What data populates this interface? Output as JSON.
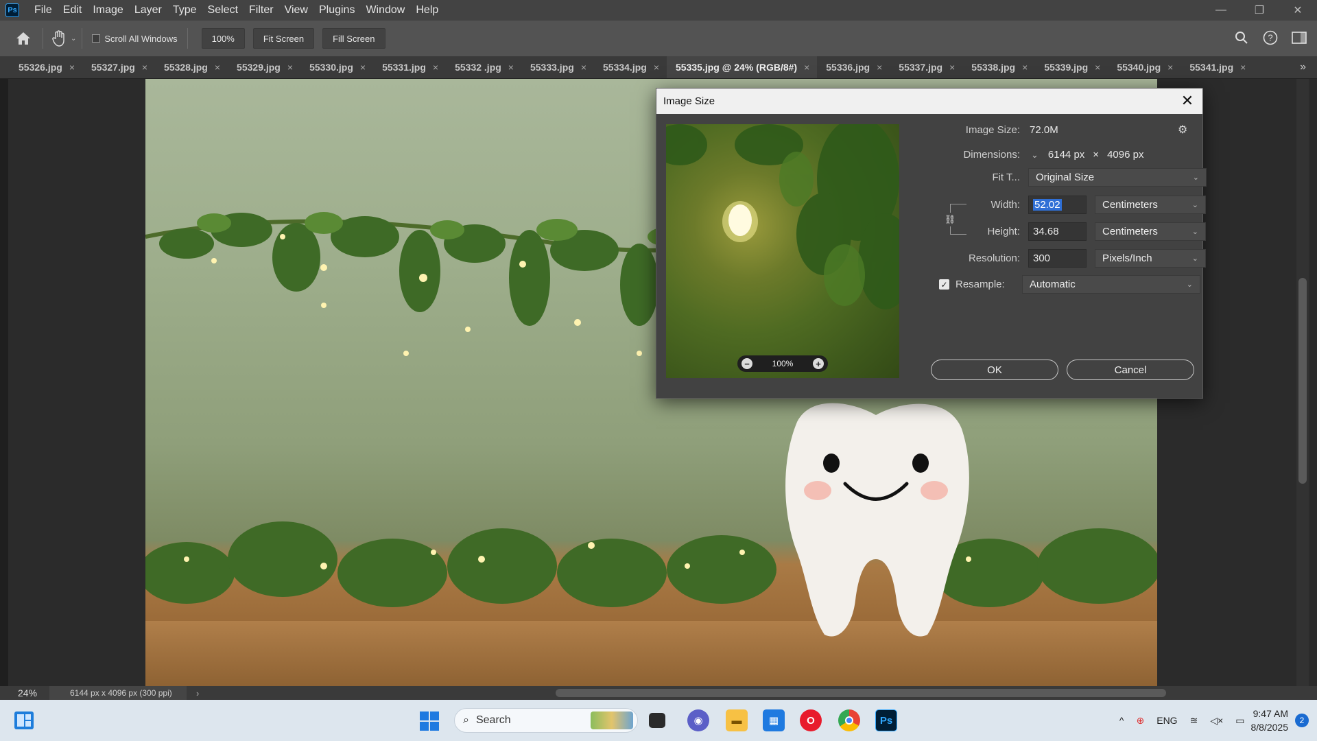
{
  "app": {
    "logo": "Ps"
  },
  "menu": [
    "File",
    "Edit",
    "Image",
    "Layer",
    "Type",
    "Select",
    "Filter",
    "View",
    "Plugins",
    "Window",
    "Help"
  ],
  "options": {
    "scroll_all_label": "Scroll All Windows",
    "zoom_value": "100%",
    "fit_screen": "Fit Screen",
    "fill_screen": "Fill Screen"
  },
  "tabs": [
    {
      "label": "55326.jpg"
    },
    {
      "label": "55327.jpg"
    },
    {
      "label": "55328.jpg"
    },
    {
      "label": "55329.jpg"
    },
    {
      "label": "55330.jpg"
    },
    {
      "label": "55331.jpg"
    },
    {
      "label": "55332 .jpg"
    },
    {
      "label": "55333.jpg"
    },
    {
      "label": "55334.jpg"
    },
    {
      "label": "55335.jpg @ 24% (RGB/8#)",
      "active": true
    },
    {
      "label": "55336.jpg"
    },
    {
      "label": "55337.jpg"
    },
    {
      "label": "55338.jpg"
    },
    {
      "label": "55339.jpg"
    },
    {
      "label": "55340.jpg"
    },
    {
      "label": "55341.jpg"
    }
  ],
  "status": {
    "zoom": "24%",
    "doc_info": "6144 px x 4096 px (300 ppi)"
  },
  "dialog": {
    "title": "Image Size",
    "image_size_label": "Image Size:",
    "image_size_value": "72.0M",
    "dimensions_label": "Dimensions:",
    "dim_width": "6144 px",
    "dim_x": "×",
    "dim_height": "4096 px",
    "fit_label": "Fit T...",
    "fit_value": "Original Size",
    "width_label": "Width:",
    "width_value": "52.02",
    "width_unit": "Centimeters",
    "height_label": "Height:",
    "height_value": "34.68",
    "height_unit": "Centimeters",
    "resolution_label": "Resolution:",
    "resolution_value": "300",
    "resolution_unit": "Pixels/Inch",
    "resample_label": "Resample:",
    "resample_checked": true,
    "resample_value": "Automatic",
    "preview_zoom": "100%",
    "ok": "OK",
    "cancel": "Cancel"
  },
  "taskbar": {
    "search_placeholder": "Search",
    "apps": [
      "file-explorer",
      "photos",
      "teams",
      "explorer-folder",
      "store",
      "opera",
      "chrome",
      "photoshop"
    ],
    "tray": {
      "language": "ENG",
      "time": "9:47 AM",
      "date": "8/8/2025",
      "notifications": "2"
    }
  },
  "colors": {
    "accent": "#31a8ff",
    "selection": "#2f6fd6",
    "dialog_bg": "#424242"
  }
}
